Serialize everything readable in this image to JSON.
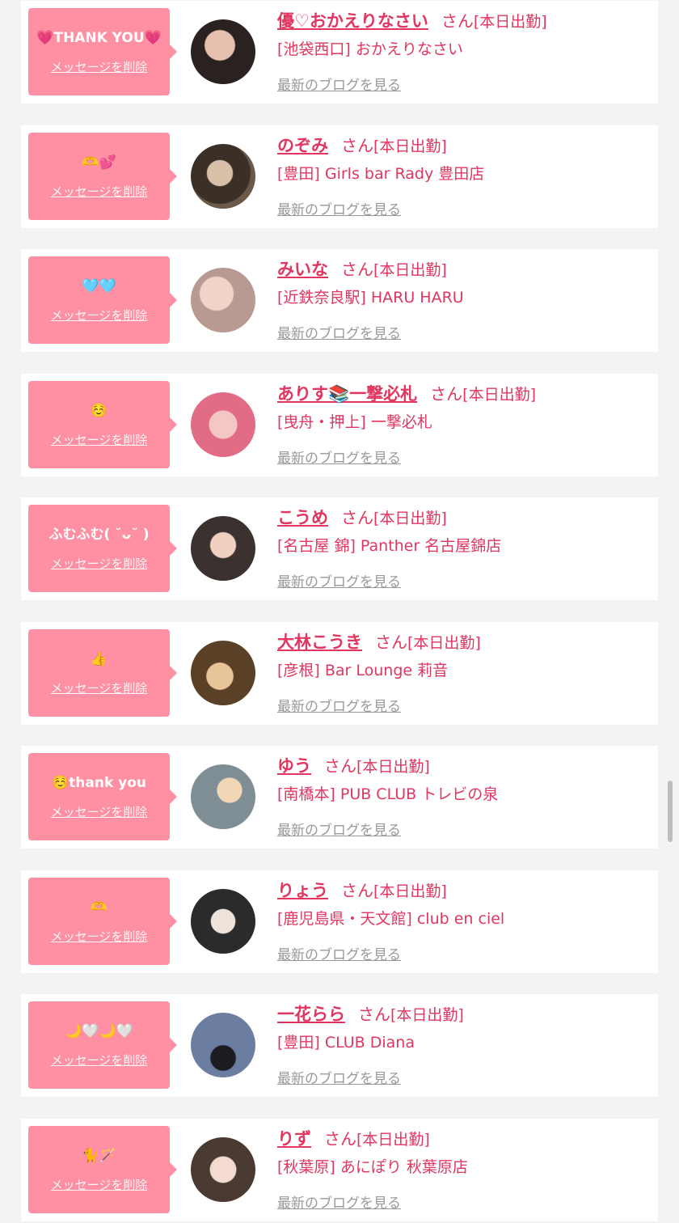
{
  "delete_label": "メッセージを削除",
  "san_label": "さん",
  "status_label": "[本日出勤]",
  "blog_label": "最新のブログを見る",
  "colors": {
    "accent": "#e0365f",
    "bubble": "#ff8fa2",
    "link_gray": "#999999",
    "page_bg": "#f3f3f3"
  },
  "entries": [
    {
      "message": "💗THANK YOU💗",
      "name": "優♡おかえりなさい",
      "shop": "[池袋西口] おかえりなさい",
      "avatar_icon": "profile-photo"
    },
    {
      "message": "🫶💕",
      "name": "のぞみ",
      "shop": "[豊田] Girls bar Rady 豊田店",
      "avatar_icon": "profile-photo"
    },
    {
      "message": "🩵🩵",
      "name": "みいな",
      "shop": "[近鉄奈良駅] HARU HARU",
      "avatar_icon": "profile-photo"
    },
    {
      "message": "☺️",
      "name": "ありす📚一撃必札",
      "shop": "[曳舟・押上] 一撃必札",
      "avatar_icon": "profile-photo"
    },
    {
      "message": "ふむふむ( ˘ᴗ˘ )",
      "name": "こうめ",
      "shop": "[名古屋 錦] Panther 名古屋錦店",
      "avatar_icon": "profile-photo"
    },
    {
      "message": "👍",
      "name": "大林こうき",
      "shop": "[彦根] Bar Lounge 莉音",
      "avatar_icon": "profile-photo"
    },
    {
      "message": "☺️thank you",
      "name": "ゆう",
      "shop": "[南橋本] PUB CLUB トレビの泉",
      "avatar_icon": "profile-photo"
    },
    {
      "message": "🫶",
      "name": "りょう",
      "shop": "[鹿児島県・天文館] club en ciel",
      "avatar_icon": "profile-photo"
    },
    {
      "message": "🌙🤍🌙🤍",
      "name": "一花らら",
      "shop": "[豊田] CLUB Diana",
      "avatar_icon": "profile-photo"
    },
    {
      "message": "🐈🪄",
      "name": "りず",
      "shop": "[秋葉原] あにぽり 秋葉原店",
      "avatar_icon": "profile-photo"
    }
  ]
}
